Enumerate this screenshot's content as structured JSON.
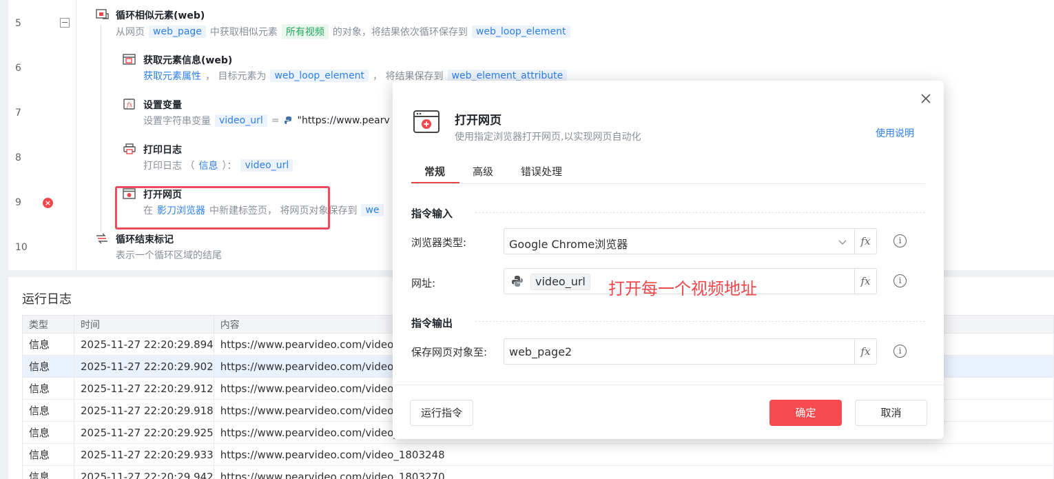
{
  "flow": {
    "line_numbers": [
      "5",
      "6",
      "7",
      "8",
      "9",
      "10"
    ],
    "steps": [
      {
        "title": "循环相似元素(web)",
        "desc": {
          "p1": "从网页",
          "var1": "web_page",
          "p2": "中获取相似元素",
          "var2": "所有视频",
          "p3": "的对象，将结果依次循环保存到",
          "var3": "web_loop_element"
        }
      },
      {
        "title": "获取元素信息(web)",
        "desc": {
          "link": "获取元素属性",
          "p1": "， 目标元素为",
          "var1": "web_loop_element",
          "p2": "， 将结果保存到",
          "var2": "web_element_attribute"
        }
      },
      {
        "title": "设置变量",
        "desc": {
          "p1": "设置字符串变量",
          "var1": "video_url",
          "p2": "=",
          "p3": "\"https://www.pearv"
        }
      },
      {
        "title": "打印日志",
        "desc": {
          "p1": "打印日志 （",
          "link": "信息",
          "p2": "）：",
          "var1": "video_url"
        }
      },
      {
        "title": "打开网页",
        "desc": {
          "p1": "在",
          "link": "影刀浏览器",
          "p2": "中新建标签页， 将网页对象保存到",
          "var1": "we"
        }
      },
      {
        "title": "循环结束标记",
        "desc": {
          "p1": "表示一个循环区域的结尾"
        }
      }
    ]
  },
  "log": {
    "title": "运行日志",
    "columns": [
      "类型",
      "时间",
      "内容"
    ],
    "rows": [
      {
        "type": "信息",
        "time": "2025-11-27 22:20:29.894",
        "content": "https://www.pearvideo.com/video_"
      },
      {
        "type": "信息",
        "time": "2025-11-27 22:20:29.902",
        "content": "https://www.pearvideo.com/video_"
      },
      {
        "type": "信息",
        "time": "2025-11-27 22:20:29.912",
        "content": "https://www.pearvideo.com/video_"
      },
      {
        "type": "信息",
        "time": "2025-11-27 22:20:29.918",
        "content": "https://www.pearvideo.com/video_"
      },
      {
        "type": "信息",
        "time": "2025-11-27 22:20:29.925",
        "content": "https://www.pearvideo.com/video_"
      },
      {
        "type": "信息",
        "time": "2025-11-27 22:20:29.933",
        "content": "https://www.pearvideo.com/video_1803248"
      },
      {
        "type": "信息",
        "time": "2025-11-27 22:20:29.942",
        "content": "https://www.pearvideo.com/video_1803270"
      }
    ]
  },
  "dialog": {
    "title": "打开网页",
    "subtitle": "使用指定浏览器打开网页,以实现网页自动化",
    "help": "使用说明",
    "tabs": [
      "常规",
      "高级",
      "错误处理"
    ],
    "input_section": "指令输入",
    "output_section": "指令输出",
    "browser_label": "浏览器类型:",
    "browser_value": "Google Chrome浏览器",
    "url_label": "网址:",
    "url_var": "video_url",
    "annotation": "打开每一个视频地址",
    "save_label": "保存网页对象至:",
    "save_value": "web_page2",
    "fx": "fx",
    "info": "i",
    "run_button": "运行指令",
    "ok_button": "确定",
    "cancel_button": "取消"
  },
  "colors": {
    "accent": "#f0474b",
    "link": "#2d7ff0",
    "tag_bg": "#ecf3fc",
    "green_tag": "#22a55b",
    "highlight_box": "#f04a5e"
  },
  "icons": [
    "loop-icon",
    "element-info-icon",
    "variable-icon",
    "printer-icon",
    "browser-icon",
    "loop-end-icon",
    "close-icon",
    "chevron-down-icon",
    "python-icon",
    "info-icon",
    "error-icon"
  ]
}
